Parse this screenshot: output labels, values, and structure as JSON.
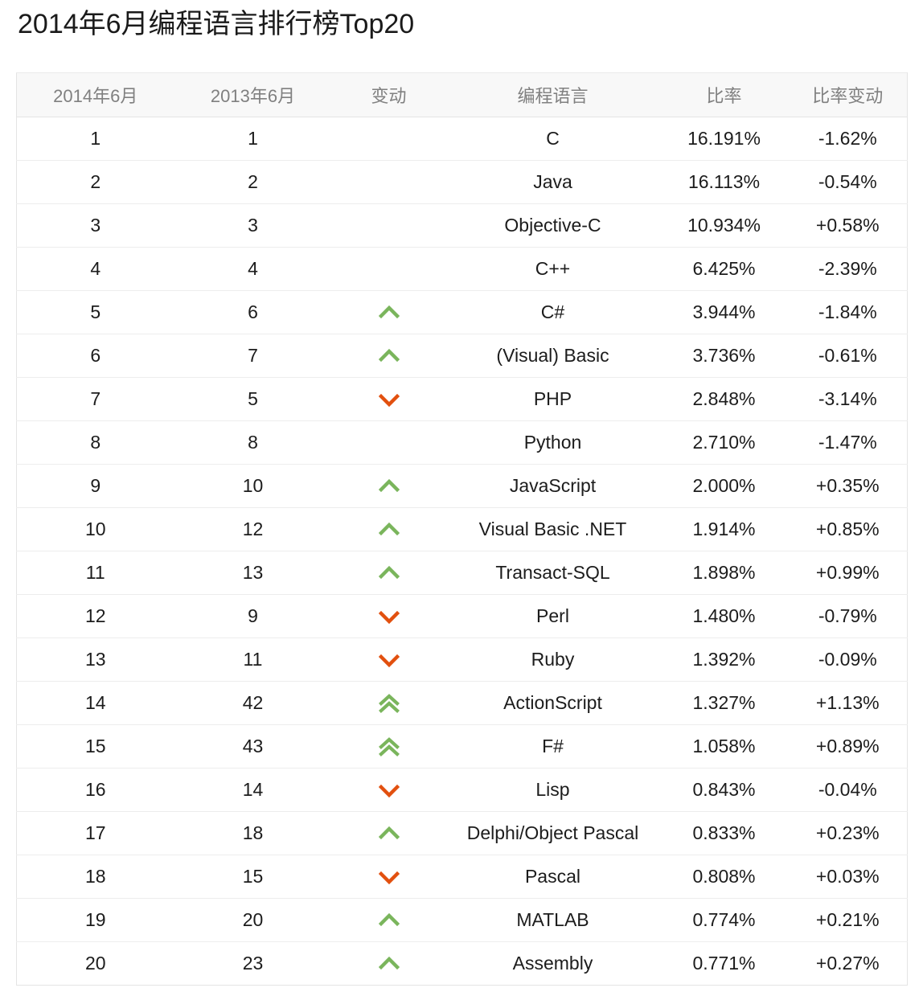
{
  "page_title": "2014年6月编程语言排行榜Top20",
  "colors": {
    "up": "#7ab55c",
    "down": "#e2500f",
    "header_text": "#808080",
    "body_text": "#1c1c1c",
    "header_bg": "#f8f8f8",
    "row_border": "#ededed"
  },
  "table": {
    "headers": [
      "2014年6月",
      "2013年6月",
      "变动",
      "编程语言",
      "比率",
      "比率变动"
    ],
    "rows": [
      {
        "rank_2014": "1",
        "rank_2013": "1",
        "change": "none",
        "change_icon": "none",
        "language": "C",
        "ratio": "16.191%",
        "ratio_change": "-1.62%"
      },
      {
        "rank_2014": "2",
        "rank_2013": "2",
        "change": "none",
        "change_icon": "none",
        "language": "Java",
        "ratio": "16.113%",
        "ratio_change": "-0.54%"
      },
      {
        "rank_2014": "3",
        "rank_2013": "3",
        "change": "none",
        "change_icon": "none",
        "language": "Objective-C",
        "ratio": "10.934%",
        "ratio_change": "+0.58%"
      },
      {
        "rank_2014": "4",
        "rank_2013": "4",
        "change": "none",
        "change_icon": "none",
        "language": "C++",
        "ratio": "6.425%",
        "ratio_change": "-2.39%"
      },
      {
        "rank_2014": "5",
        "rank_2013": "6",
        "change": "up",
        "change_icon": "chevron-up-icon",
        "language": "C#",
        "ratio": "3.944%",
        "ratio_change": "-1.84%"
      },
      {
        "rank_2014": "6",
        "rank_2013": "7",
        "change": "up",
        "change_icon": "chevron-up-icon",
        "language": "(Visual) Basic",
        "ratio": "3.736%",
        "ratio_change": "-0.61%"
      },
      {
        "rank_2014": "7",
        "rank_2013": "5",
        "change": "down",
        "change_icon": "chevron-down-icon",
        "language": "PHP",
        "ratio": "2.848%",
        "ratio_change": "-3.14%"
      },
      {
        "rank_2014": "8",
        "rank_2013": "8",
        "change": "none",
        "change_icon": "none",
        "language": "Python",
        "ratio": "2.710%",
        "ratio_change": "-1.47%"
      },
      {
        "rank_2014": "9",
        "rank_2013": "10",
        "change": "up",
        "change_icon": "chevron-up-icon",
        "language": "JavaScript",
        "ratio": "2.000%",
        "ratio_change": "+0.35%"
      },
      {
        "rank_2014": "10",
        "rank_2013": "12",
        "change": "up",
        "change_icon": "chevron-up-icon",
        "language": "Visual Basic .NET",
        "ratio": "1.914%",
        "ratio_change": "+0.85%"
      },
      {
        "rank_2014": "11",
        "rank_2013": "13",
        "change": "up",
        "change_icon": "chevron-up-icon",
        "language": "Transact-SQL",
        "ratio": "1.898%",
        "ratio_change": "+0.99%"
      },
      {
        "rank_2014": "12",
        "rank_2013": "9",
        "change": "down",
        "change_icon": "chevron-down-icon",
        "language": "Perl",
        "ratio": "1.480%",
        "ratio_change": "-0.79%"
      },
      {
        "rank_2014": "13",
        "rank_2013": "11",
        "change": "down",
        "change_icon": "chevron-down-icon",
        "language": "Ruby",
        "ratio": "1.392%",
        "ratio_change": "-0.09%"
      },
      {
        "rank_2014": "14",
        "rank_2013": "42",
        "change": "up-double",
        "change_icon": "double-chevron-up-icon",
        "language": "ActionScript",
        "ratio": "1.327%",
        "ratio_change": "+1.13%"
      },
      {
        "rank_2014": "15",
        "rank_2013": "43",
        "change": "up-double",
        "change_icon": "double-chevron-up-icon",
        "language": "F#",
        "ratio": "1.058%",
        "ratio_change": "+0.89%"
      },
      {
        "rank_2014": "16",
        "rank_2013": "14",
        "change": "down",
        "change_icon": "chevron-down-icon",
        "language": "Lisp",
        "ratio": "0.843%",
        "ratio_change": "-0.04%"
      },
      {
        "rank_2014": "17",
        "rank_2013": "18",
        "change": "up",
        "change_icon": "chevron-up-icon",
        "language": "Delphi/Object Pascal",
        "ratio": "0.833%",
        "ratio_change": "+0.23%"
      },
      {
        "rank_2014": "18",
        "rank_2013": "15",
        "change": "down",
        "change_icon": "chevron-down-icon",
        "language": "Pascal",
        "ratio": "0.808%",
        "ratio_change": "+0.03%"
      },
      {
        "rank_2014": "19",
        "rank_2013": "20",
        "change": "up",
        "change_icon": "chevron-up-icon",
        "language": "MATLAB",
        "ratio": "0.774%",
        "ratio_change": "+0.21%"
      },
      {
        "rank_2014": "20",
        "rank_2013": "23",
        "change": "up",
        "change_icon": "chevron-up-icon",
        "language": "Assembly",
        "ratio": "0.771%",
        "ratio_change": "+0.27%"
      }
    ]
  },
  "chart_data": {
    "type": "table",
    "title": "2014年6月编程语言排行榜Top20",
    "columns": [
      "2014年6月",
      "2013年6月",
      "变动",
      "编程语言",
      "比率",
      "比率变动"
    ],
    "categories": [
      "C",
      "Java",
      "Objective-C",
      "C++",
      "C#",
      "(Visual) Basic",
      "PHP",
      "Python",
      "JavaScript",
      "Visual Basic .NET",
      "Transact-SQL",
      "Perl",
      "Ruby",
      "ActionScript",
      "F#",
      "Lisp",
      "Delphi/Object Pascal",
      "Pascal",
      "MATLAB",
      "Assembly"
    ],
    "series": [
      {
        "name": "比率",
        "values": [
          16.191,
          16.113,
          10.934,
          6.425,
          3.944,
          3.736,
          2.848,
          2.71,
          2.0,
          1.914,
          1.898,
          1.48,
          1.392,
          1.327,
          1.058,
          0.843,
          0.833,
          0.808,
          0.774,
          0.771
        ]
      },
      {
        "name": "比率变动",
        "values": [
          -1.62,
          -0.54,
          0.58,
          -2.39,
          -1.84,
          -0.61,
          -3.14,
          -1.47,
          0.35,
          0.85,
          0.99,
          -0.79,
          -0.09,
          1.13,
          0.89,
          -0.04,
          0.23,
          0.03,
          0.21,
          0.27
        ]
      },
      {
        "name": "2014年6月排名",
        "values": [
          1,
          2,
          3,
          4,
          5,
          6,
          7,
          8,
          9,
          10,
          11,
          12,
          13,
          14,
          15,
          16,
          17,
          18,
          19,
          20
        ]
      },
      {
        "name": "2013年6月排名",
        "values": [
          1,
          2,
          3,
          4,
          6,
          7,
          5,
          8,
          10,
          12,
          13,
          9,
          11,
          42,
          43,
          14,
          18,
          15,
          20,
          23
        ]
      }
    ],
    "ylabel": "比率 (%)",
    "xlabel": "编程语言"
  }
}
